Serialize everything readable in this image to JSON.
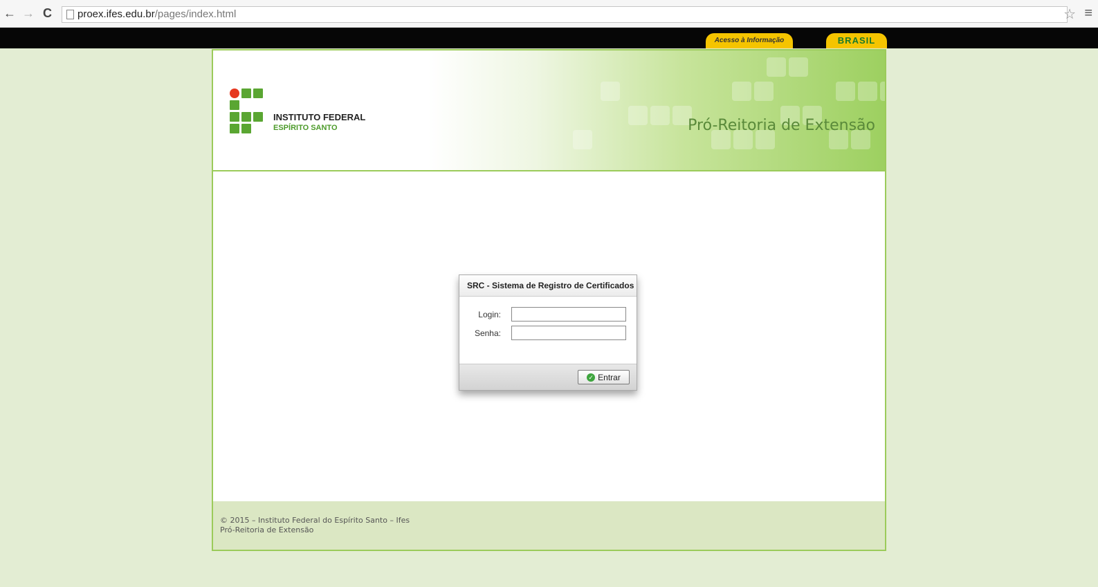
{
  "browser": {
    "url_host": "proex.ifes.edu.br",
    "url_path": "/pages/index.html"
  },
  "gov_bar": {
    "acesso": "Acesso à Informação",
    "brasil": "BRASIL"
  },
  "header": {
    "institution_name": "INSTITUTO FEDERAL",
    "institution_sub": "ESPÍRITO SANTO",
    "title": "Pró-Reitoria de Extensão"
  },
  "dialog": {
    "title": "SRC - Sistema de Registro de Certificados",
    "login_label": "Login:",
    "senha_label": "Senha:",
    "login_value": "",
    "senha_value": "",
    "enter_label": "Entrar"
  },
  "footer": {
    "line1": "© 2015 – Instituto Federal do Espírito Santo – Ifes",
    "line2": "Pró-Reitoria de Extensão"
  },
  "colors": {
    "accent_green": "#9bcb5a",
    "background": "#e3edd3",
    "gov_yellow": "#f5c400",
    "logo_red": "#e6371f"
  },
  "icons": [
    "back-arrow-icon",
    "forward-arrow-icon",
    "reload-icon",
    "page-icon",
    "star-icon",
    "menu-icon",
    "check-icon"
  ]
}
